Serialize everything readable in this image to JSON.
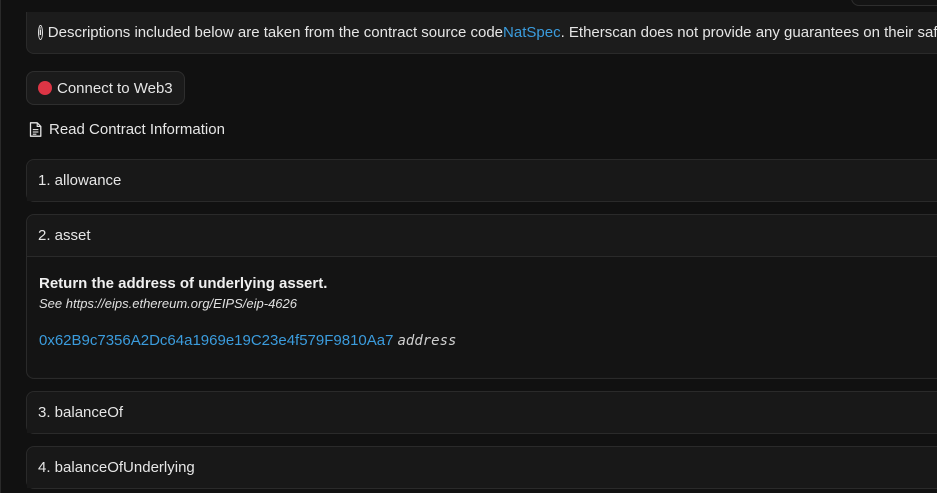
{
  "notice": {
    "text_before": "Descriptions included below are taken from the contract source code ",
    "link_text": "NatSpec",
    "text_after": ". Etherscan does not provide any guarantees on their safety or accuracy."
  },
  "connect": {
    "label": "Connect to Web3",
    "status_color": "#dc3545"
  },
  "section": {
    "title": "Read Contract Information"
  },
  "functions": [
    {
      "label": "1. allowance"
    },
    {
      "label": "2. asset",
      "description": "Return the address of underlying assert.",
      "note": "See https://eips.ethereum.org/EIPS/eip-4626",
      "result_value": "0x62B9c7356A2Dc64a1969e19C23e4f579F9810Aa7",
      "result_type": "address"
    },
    {
      "label": "3. balanceOf"
    },
    {
      "label": "4. balanceOfUnderlying"
    }
  ],
  "colors": {
    "background": "#111111",
    "link": "#3b9cdd",
    "card": "#161616",
    "border": "#2a2a2a"
  },
  "icons": [
    "info-icon",
    "red-status-dot-icon",
    "document-icon"
  ]
}
